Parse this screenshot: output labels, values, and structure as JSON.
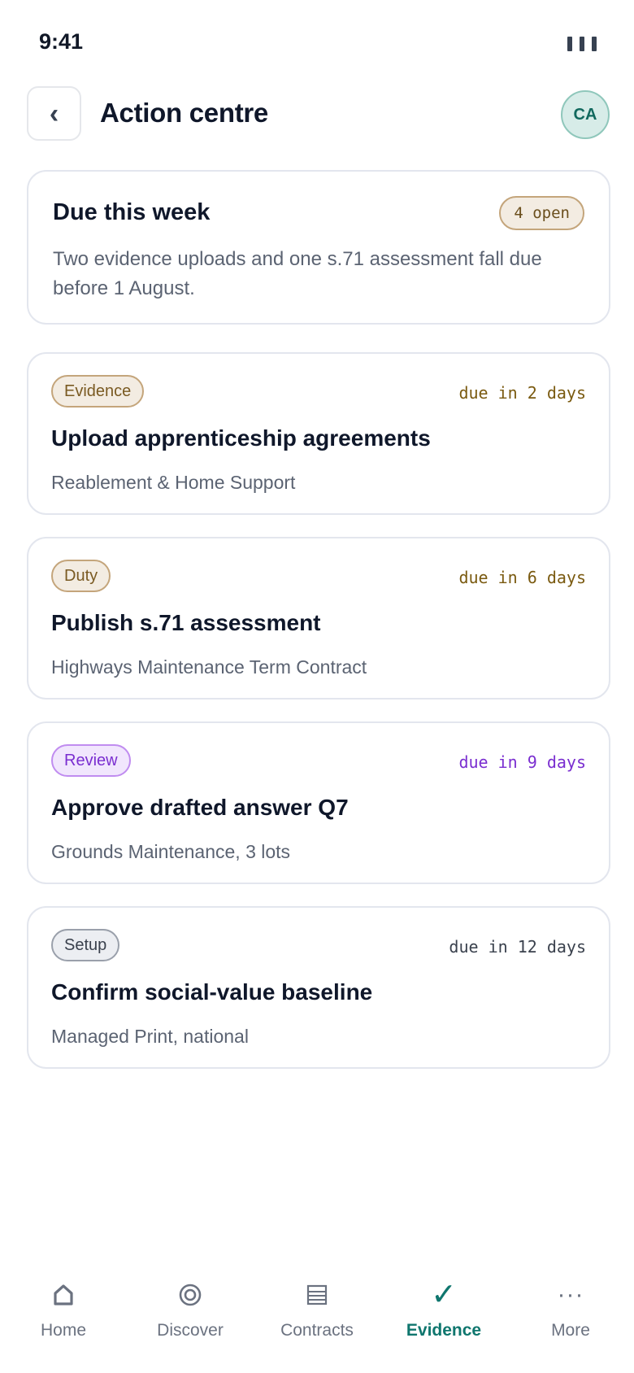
{
  "status_bar": {
    "time": "9:41"
  },
  "header": {
    "title": "Action centre",
    "avatar_initials": "CA"
  },
  "summary": {
    "title": "Due this week",
    "badge": "4 open",
    "text": "Two evidence uploads and one s.71 assessment fall due before 1 August."
  },
  "tasks": [
    {
      "tag": "Evidence",
      "due": "due in 2 days",
      "title": "Upload apprenticeship agreements",
      "subtitle": "Reablement & Home Support"
    },
    {
      "tag": "Duty",
      "due": "due in 6 days",
      "title": "Publish s.71 assessment",
      "subtitle": "Highways Maintenance Term Contract"
    },
    {
      "tag": "Review",
      "due": "due in 9 days",
      "title": "Approve drafted answer Q7",
      "subtitle": "Grounds Maintenance, 3 lots"
    },
    {
      "tag": "Setup",
      "due": "due in 12 days",
      "title": "Confirm social-value baseline",
      "subtitle": "Managed Print, national"
    }
  ],
  "tabbar": {
    "items": [
      {
        "label": "Home",
        "icon": "home-icon"
      },
      {
        "label": "Discover",
        "icon": "discover-icon"
      },
      {
        "label": "Contracts",
        "icon": "contracts-icon"
      },
      {
        "label": "Evidence",
        "icon": "check-icon",
        "active": true
      },
      {
        "label": "More",
        "icon": "more-icon"
      }
    ]
  },
  "colors": {
    "accent": "#0f766e",
    "evidence_chip": "#f3ece2",
    "review_chip": "#f1e6fd",
    "setup_chip": "#eceef2"
  }
}
